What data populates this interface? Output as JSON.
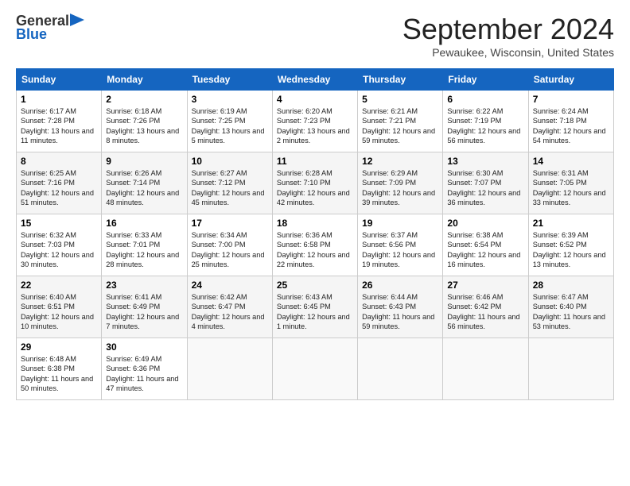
{
  "header": {
    "logo_general": "General",
    "logo_blue": "Blue",
    "month_title": "September 2024",
    "location": "Pewaukee, Wisconsin, United States"
  },
  "days_of_week": [
    "Sunday",
    "Monday",
    "Tuesday",
    "Wednesday",
    "Thursday",
    "Friday",
    "Saturday"
  ],
  "weeks": [
    [
      {
        "day": "1",
        "info": "Sunrise: 6:17 AM\nSunset: 7:28 PM\nDaylight: 13 hours and 11 minutes."
      },
      {
        "day": "2",
        "info": "Sunrise: 6:18 AM\nSunset: 7:26 PM\nDaylight: 13 hours and 8 minutes."
      },
      {
        "day": "3",
        "info": "Sunrise: 6:19 AM\nSunset: 7:25 PM\nDaylight: 13 hours and 5 minutes."
      },
      {
        "day": "4",
        "info": "Sunrise: 6:20 AM\nSunset: 7:23 PM\nDaylight: 13 hours and 2 minutes."
      },
      {
        "day": "5",
        "info": "Sunrise: 6:21 AM\nSunset: 7:21 PM\nDaylight: 12 hours and 59 minutes."
      },
      {
        "day": "6",
        "info": "Sunrise: 6:22 AM\nSunset: 7:19 PM\nDaylight: 12 hours and 56 minutes."
      },
      {
        "day": "7",
        "info": "Sunrise: 6:24 AM\nSunset: 7:18 PM\nDaylight: 12 hours and 54 minutes."
      }
    ],
    [
      {
        "day": "8",
        "info": "Sunrise: 6:25 AM\nSunset: 7:16 PM\nDaylight: 12 hours and 51 minutes."
      },
      {
        "day": "9",
        "info": "Sunrise: 6:26 AM\nSunset: 7:14 PM\nDaylight: 12 hours and 48 minutes."
      },
      {
        "day": "10",
        "info": "Sunrise: 6:27 AM\nSunset: 7:12 PM\nDaylight: 12 hours and 45 minutes."
      },
      {
        "day": "11",
        "info": "Sunrise: 6:28 AM\nSunset: 7:10 PM\nDaylight: 12 hours and 42 minutes."
      },
      {
        "day": "12",
        "info": "Sunrise: 6:29 AM\nSunset: 7:09 PM\nDaylight: 12 hours and 39 minutes."
      },
      {
        "day": "13",
        "info": "Sunrise: 6:30 AM\nSunset: 7:07 PM\nDaylight: 12 hours and 36 minutes."
      },
      {
        "day": "14",
        "info": "Sunrise: 6:31 AM\nSunset: 7:05 PM\nDaylight: 12 hours and 33 minutes."
      }
    ],
    [
      {
        "day": "15",
        "info": "Sunrise: 6:32 AM\nSunset: 7:03 PM\nDaylight: 12 hours and 30 minutes."
      },
      {
        "day": "16",
        "info": "Sunrise: 6:33 AM\nSunset: 7:01 PM\nDaylight: 12 hours and 28 minutes."
      },
      {
        "day": "17",
        "info": "Sunrise: 6:34 AM\nSunset: 7:00 PM\nDaylight: 12 hours and 25 minutes."
      },
      {
        "day": "18",
        "info": "Sunrise: 6:36 AM\nSunset: 6:58 PM\nDaylight: 12 hours and 22 minutes."
      },
      {
        "day": "19",
        "info": "Sunrise: 6:37 AM\nSunset: 6:56 PM\nDaylight: 12 hours and 19 minutes."
      },
      {
        "day": "20",
        "info": "Sunrise: 6:38 AM\nSunset: 6:54 PM\nDaylight: 12 hours and 16 minutes."
      },
      {
        "day": "21",
        "info": "Sunrise: 6:39 AM\nSunset: 6:52 PM\nDaylight: 12 hours and 13 minutes."
      }
    ],
    [
      {
        "day": "22",
        "info": "Sunrise: 6:40 AM\nSunset: 6:51 PM\nDaylight: 12 hours and 10 minutes."
      },
      {
        "day": "23",
        "info": "Sunrise: 6:41 AM\nSunset: 6:49 PM\nDaylight: 12 hours and 7 minutes."
      },
      {
        "day": "24",
        "info": "Sunrise: 6:42 AM\nSunset: 6:47 PM\nDaylight: 12 hours and 4 minutes."
      },
      {
        "day": "25",
        "info": "Sunrise: 6:43 AM\nSunset: 6:45 PM\nDaylight: 12 hours and 1 minute."
      },
      {
        "day": "26",
        "info": "Sunrise: 6:44 AM\nSunset: 6:43 PM\nDaylight: 11 hours and 59 minutes."
      },
      {
        "day": "27",
        "info": "Sunrise: 6:46 AM\nSunset: 6:42 PM\nDaylight: 11 hours and 56 minutes."
      },
      {
        "day": "28",
        "info": "Sunrise: 6:47 AM\nSunset: 6:40 PM\nDaylight: 11 hours and 53 minutes."
      }
    ],
    [
      {
        "day": "29",
        "info": "Sunrise: 6:48 AM\nSunset: 6:38 PM\nDaylight: 11 hours and 50 minutes."
      },
      {
        "day": "30",
        "info": "Sunrise: 6:49 AM\nSunset: 6:36 PM\nDaylight: 11 hours and 47 minutes."
      },
      null,
      null,
      null,
      null,
      null
    ]
  ]
}
